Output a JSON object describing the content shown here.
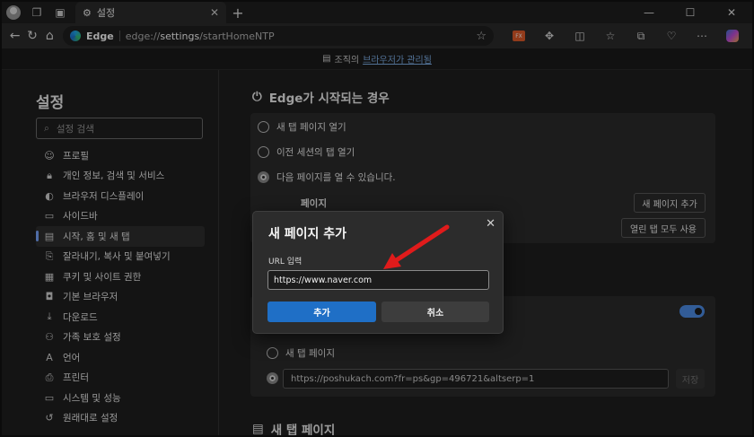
{
  "titlebar": {
    "tab_title": "설정",
    "icons": [
      "profile-avatar",
      "workspaces-icon",
      "tab-actions-icon",
      "gear-icon",
      "close-icon",
      "plus-icon"
    ],
    "window_controls": [
      "minimize-icon",
      "maximize-icon",
      "close-icon"
    ]
  },
  "addressbar": {
    "brand": "Edge",
    "url_prefix": "edge://",
    "url_bold": "settings",
    "url_suffix": "/startHomeNTP"
  },
  "managed_bar": {
    "prefix": "조직의",
    "link": "브라우저가 관리됨"
  },
  "sidebar": {
    "title": "설정",
    "search_placeholder": "설정 검색",
    "items": [
      {
        "label": "프로필",
        "icon": "profile-icon"
      },
      {
        "label": "개인 정보, 검색 및 서비스",
        "icon": "lock-icon"
      },
      {
        "label": "브라우저 디스플레이",
        "icon": "palette-icon"
      },
      {
        "label": "사이드바",
        "icon": "sidebar-icon"
      },
      {
        "label": "시작, 홈 및 새 탭",
        "icon": "home-tab-icon"
      },
      {
        "label": "잘라내기, 복사 및 붙여넣기",
        "icon": "clipboard-icon"
      },
      {
        "label": "쿠키 및 사이트 권한",
        "icon": "cookie-icon"
      },
      {
        "label": "기본 브라우저",
        "icon": "browser-icon"
      },
      {
        "label": "다운로드",
        "icon": "download-icon"
      },
      {
        "label": "가족 보호 설정",
        "icon": "family-icon"
      },
      {
        "label": "언어",
        "icon": "language-icon"
      },
      {
        "label": "프린터",
        "icon": "printer-icon"
      },
      {
        "label": "시스템 및 성능",
        "icon": "laptop-icon"
      },
      {
        "label": "원래대로 설정",
        "icon": "reset-icon"
      }
    ]
  },
  "main": {
    "section1_title": "Edge가 시작되는 경우",
    "startup_options": [
      "새 탭 페이지 열기",
      "이전 세션의 탭 열기",
      "다음 페이지를 열 수 있습니다."
    ],
    "pages_label": "페이지",
    "add_page_button": "새 페이지 추가",
    "use_open_tabs_button": "열린 탭 모두 사용",
    "home_options": [
      "새 탭 페이지"
    ],
    "home_url": "https://poshukach.com?fr=ps&gp=496721&altserp=1",
    "save_button": "저장",
    "section2_title": "새 탭 페이지"
  },
  "dialog": {
    "title": "새 페이지 추가",
    "url_label": "URL 입력",
    "url_value": "https://www.naver.com",
    "add_button": "추가",
    "cancel_button": "취소"
  },
  "colors": {
    "accent": "#1f6fc6",
    "arrow": "#e01b1b",
    "toggle_on": "#4d8ee8"
  }
}
